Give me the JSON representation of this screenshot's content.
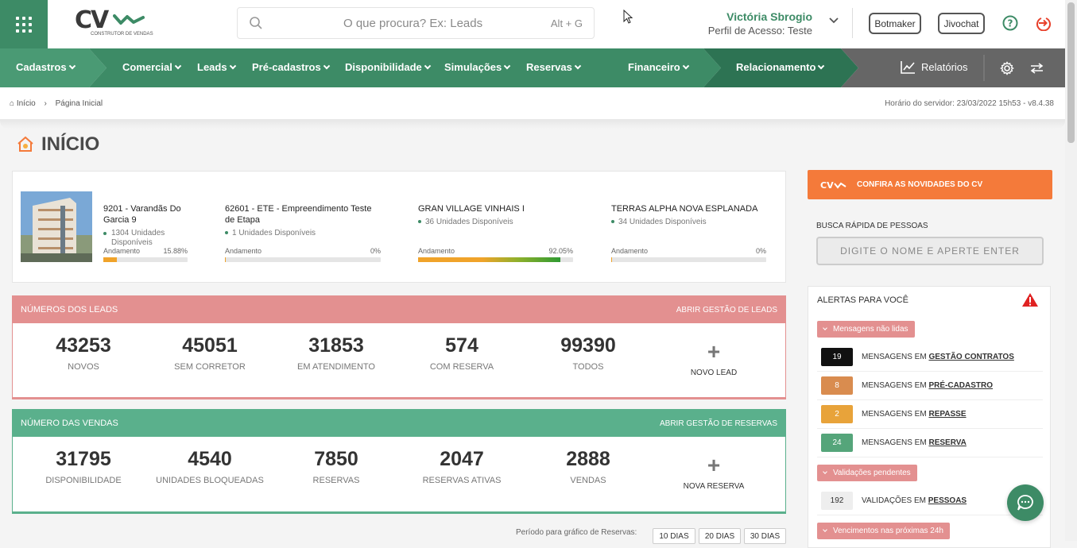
{
  "header": {
    "search_placeholder": "O que procura? Ex: Leads",
    "search_shortcut": "Alt + G",
    "user_name": "Victória Sbrogio",
    "user_role": "Perfil de Acesso: Teste",
    "btn_botmaker": "Botmaker",
    "btn_jivochat": "Jivochat",
    "logo_text": "CV",
    "logo_sub": "CONSTRUTOR DE VENDAS"
  },
  "nav": {
    "items": [
      "Cadastros",
      "Comercial",
      "Leads",
      "Pré-cadastros",
      "Disponibilidade",
      "Simulações",
      "Reservas",
      "Financeiro",
      "Relacionamento"
    ],
    "relatorios": "Relatórios"
  },
  "breadcrumb": {
    "home": "Início",
    "current": "Página Inicial",
    "server_time": "Horário do servidor: 23/03/2022 15h53 - v8.4.38"
  },
  "page": {
    "title": "INÍCIO"
  },
  "empreendimentos": [
    {
      "name": "9201 - Varandãs Do Garcia 9",
      "units": "1304 Unidades Disponíveis",
      "progress_label": "Andamento",
      "progress": "15.88%",
      "progress_value": 15.88
    },
    {
      "name": "62601 - ETE - Empreendimento Teste de Etapa",
      "units": "1 Unidades Disponíveis",
      "progress_label": "Andamento",
      "progress": "0%",
      "progress_value": 0
    },
    {
      "name": "GRAN VILLAGE VINHAIS I",
      "units": "36 Unidades Disponíveis",
      "progress_label": "Andamento",
      "progress": "92.05%",
      "progress_value": 92.05
    },
    {
      "name": "TERRAS ALPHA NOVA ESPLANADA",
      "units": "34 Unidades Disponíveis",
      "progress_label": "Andamento",
      "progress": "0%",
      "progress_value": 0
    }
  ],
  "leads": {
    "title": "NÚMEROS DOS LEADS",
    "action": "ABRIR GESTÃO DE LEADS",
    "stats": [
      {
        "value": "43253",
        "label": "NOVOS"
      },
      {
        "value": "45051",
        "label": "SEM CORRETOR"
      },
      {
        "value": "31853",
        "label": "EM ATENDIMENTO"
      },
      {
        "value": "574",
        "label": "COM RESERVA"
      },
      {
        "value": "99390",
        "label": "TODOS"
      }
    ],
    "new_label": "NOVO LEAD"
  },
  "vendas": {
    "title": "NÚMERO DAS VENDAS",
    "action": "ABRIR GESTÃO DE RESERVAS",
    "stats": [
      {
        "value": "31795",
        "label": "DISPONIBILIDADE"
      },
      {
        "value": "4540",
        "label": "UNIDADES BLOQUEADAS"
      },
      {
        "value": "7850",
        "label": "RESERVAS"
      },
      {
        "value": "2047",
        "label": "RESERVAS ATIVAS"
      },
      {
        "value": "2888",
        "label": "VENDAS"
      }
    ],
    "new_label": "NOVA RESERVA"
  },
  "period": {
    "label": "Período para gráfico de Reservas:",
    "options": [
      "10 DIAS",
      "20 DIAS",
      "30 DIAS"
    ]
  },
  "sidebar": {
    "novidades": "CONFIRA AS NOVIDADES DO CV",
    "quick_search_label": "BUSCA RÁPIDA DE PESSOAS",
    "quick_search_placeholder": "DIGITE O NOME E APERTE ENTER",
    "alerts_title": "ALERTAS PARA VOCÊ",
    "groups": [
      {
        "label": "Mensagens não lidas"
      },
      {
        "label": "Validações pendentes"
      },
      {
        "label": "Vencimentos nas próximas 24h"
      }
    ],
    "messages": [
      {
        "count": "19",
        "prefix": "MENSAGENS EM ",
        "target": "GESTÃO CONTRATOS",
        "color": "#111111"
      },
      {
        "count": "8",
        "prefix": "MENSAGENS EM ",
        "target": "PRÉ-CADASTRO",
        "color": "#d98c4f"
      },
      {
        "count": "2",
        "prefix": "MENSAGENS EM ",
        "target": "REPASSE",
        "color": "#e8a33a"
      },
      {
        "count": "24",
        "prefix": "MENSAGENS EM ",
        "target": "RESERVA",
        "color": "#55a57a"
      }
    ],
    "validations": [
      {
        "count": "192",
        "prefix": "VALIDAÇÕES EM ",
        "target": "PESSOAS",
        "color": "#eeeeee"
      }
    ]
  },
  "colors": {
    "brand_green": "#3d8b66",
    "leads_red": "#e39090",
    "vendas_green": "#5ab08c",
    "orange": "#f47a3a"
  }
}
